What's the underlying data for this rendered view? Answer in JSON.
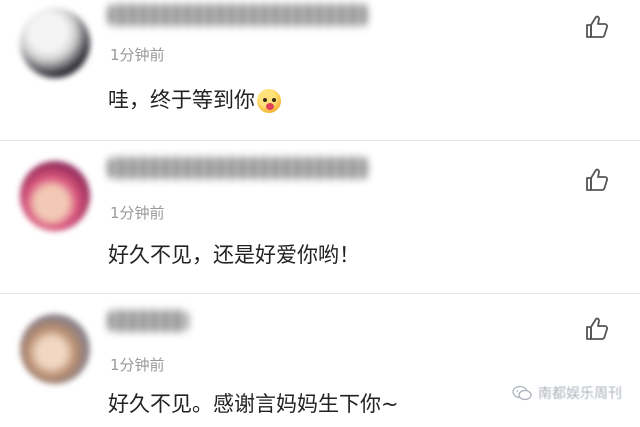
{
  "comments": [
    {
      "username_hidden": true,
      "time": "1分钟前",
      "text": "哇，终于等到你",
      "has_emoji": true,
      "emoji_icon": "blush-face-emoji"
    },
    {
      "username_hidden": true,
      "time": "1分钟前",
      "text": "好久不见，还是好爱你哟！"
    },
    {
      "username_hidden": true,
      "time": "1分钟前",
      "text": "好久不见。感谢言妈妈生下你~"
    }
  ],
  "like_icon": "thumbs-up-icon",
  "watermark": {
    "text": "南都娱乐周刊",
    "icon": "wechat-logo-icon"
  },
  "colors": {
    "divider": "#e6e6e6",
    "timestamp": "#9a9a9a",
    "text": "#222222",
    "icon": "#555555"
  }
}
